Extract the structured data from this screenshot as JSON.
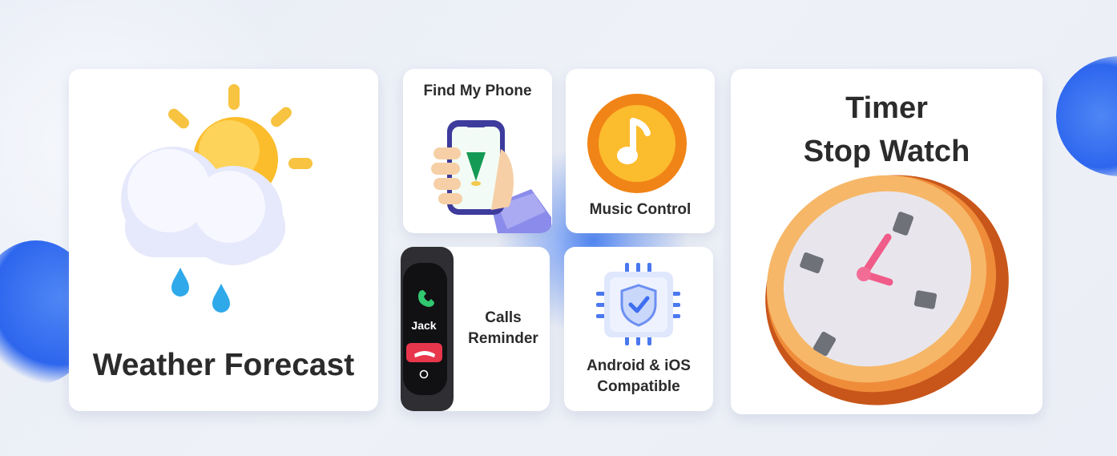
{
  "features": {
    "weather": {
      "label": "Weather Forecast"
    },
    "find_phone": {
      "label": "Find My Phone"
    },
    "music": {
      "label": "Music Control"
    },
    "timer": {
      "line1": "Timer",
      "line2": "Stop Watch"
    },
    "calls": {
      "line1": "Calls",
      "line2": "Reminder",
      "caller": "Jack"
    },
    "compat": {
      "line1": "Android & iOS",
      "line2": "Compatible"
    }
  },
  "colors": {
    "accent_blue": "#2f6cf2",
    "sun_yellow": "#fbc531",
    "music_orange": "#f18416",
    "clock_orange": "#e86a1c",
    "clock_hand_pink": "#f05c8a",
    "decline_red": "#e8364c",
    "locator_green": "#159a55"
  },
  "icons": [
    "weather-icon",
    "phone-locate-icon",
    "music-note-icon",
    "clock-icon",
    "smartband-icon",
    "chip-shield-icon"
  ]
}
